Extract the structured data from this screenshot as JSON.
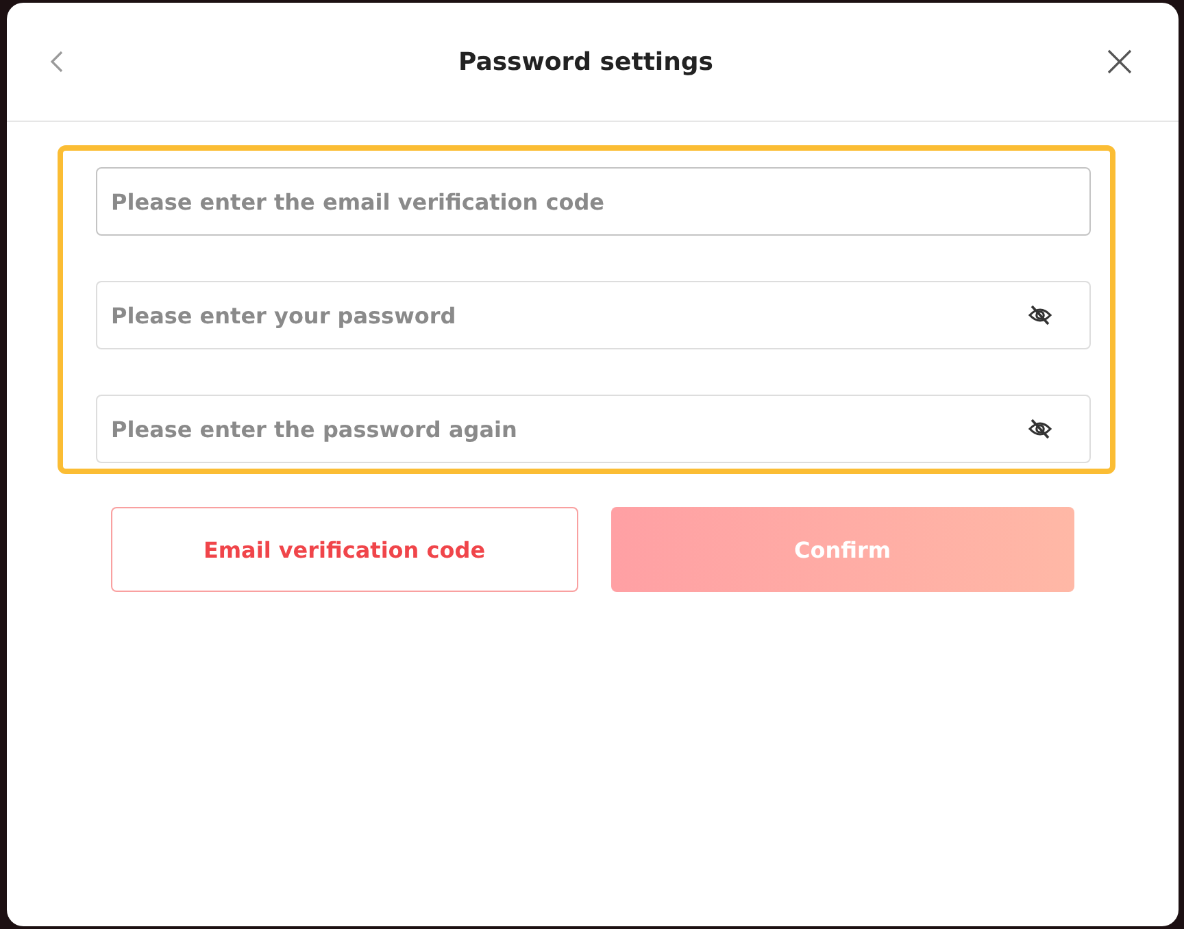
{
  "dialog": {
    "title": "Password settings"
  },
  "fields": [
    {
      "kind": "text",
      "placeholder": "Please enter the email verification code",
      "focused": true
    },
    {
      "kind": "password",
      "placeholder": "Please enter your password",
      "focused": false
    },
    {
      "kind": "password",
      "placeholder": "Please enter the password again",
      "focused": false
    }
  ],
  "buttons": [
    {
      "kind": "outline",
      "label": "Email verification code",
      "disabled": false
    },
    {
      "kind": "primary",
      "label": "Confirm",
      "disabled": true
    }
  ]
}
